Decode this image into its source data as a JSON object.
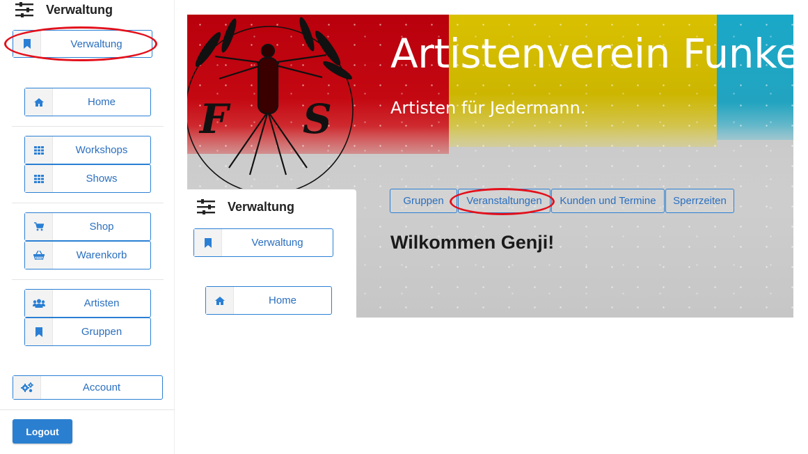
{
  "sidebar": {
    "header": {
      "title": "Verwaltung",
      "icon": "sliders-icon"
    },
    "admin_button": {
      "label": "Verwaltung",
      "icon": "bookmark-icon"
    },
    "items": [
      {
        "label": "Home",
        "icon": "home-icon"
      },
      {
        "label": "Workshops",
        "icon": "grid-icon"
      },
      {
        "label": "Shows",
        "icon": "grid-icon"
      },
      {
        "label": "Shop",
        "icon": "cart-icon"
      },
      {
        "label": "Warenkorb",
        "icon": "basket-icon"
      },
      {
        "label": "Artisten",
        "icon": "users-icon"
      },
      {
        "label": "Gruppen",
        "icon": "bookmark-icon"
      }
    ],
    "account": {
      "label": "Account",
      "icon": "cogs-icon"
    },
    "logout": {
      "label": "Logout"
    }
  },
  "hero": {
    "title": "Artistenverein Funke",
    "subtitle": "Artisten für Jedermann.",
    "tabs": [
      {
        "label": "Gruppen"
      },
      {
        "label": "Veranstaltungen"
      },
      {
        "label": "Kunden und Termine"
      },
      {
        "label": "Sperrzeiten"
      }
    ],
    "welcome": "Wilkommen Genji!"
  },
  "overlay_panel": {
    "header": {
      "title": "Verwaltung"
    },
    "admin_button": {
      "label": "Verwaltung"
    },
    "home_button": {
      "label": "Home"
    }
  },
  "colors": {
    "accent": "#2a7fd4",
    "annotation": "#e3101b",
    "hero_red": "#c40812",
    "hero_yellow": "#d9c000",
    "hero_cyan": "#1aa8c8"
  }
}
